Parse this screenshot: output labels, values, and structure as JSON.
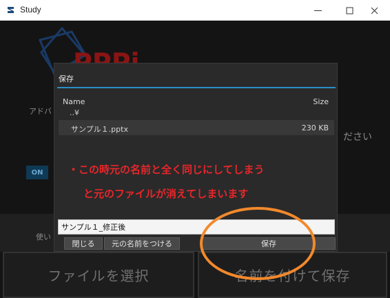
{
  "window": {
    "title": "Study"
  },
  "background": {
    "left_label": "アドバ",
    "right_label": "ださい",
    "toggle_label": "ON",
    "left_label2": "使い",
    "select_file_button": "ファイルを選択",
    "save_as_button": "名前を付けて保存",
    "logo_text": "PPPi"
  },
  "dialog": {
    "title": "保存",
    "columns": {
      "name": "Name",
      "size": "Size"
    },
    "parent_dir": "..¥",
    "files": [
      {
        "name": "サンプル１.pptx",
        "size": "230 KB"
      }
    ],
    "filename_value": "サンプル１_修正後",
    "buttons": {
      "close": "閉じる",
      "use_original_name": "元の名前をつける",
      "save": "保存"
    }
  },
  "annotation": {
    "line1": "・この時元の名前と全く同じにしてしまう",
    "line2": "と元のファイルが消えてしまいます",
    "color": "#e8262a",
    "ring_color": "#f2892c"
  },
  "colors": {
    "accent": "#2c8fc9"
  }
}
